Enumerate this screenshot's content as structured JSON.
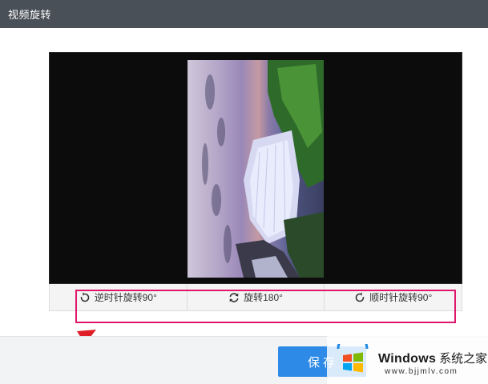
{
  "window": {
    "title": "视频旋转"
  },
  "controls": [
    {
      "label": "逆时针旋转90°",
      "icon": "rotate-ccw-icon"
    },
    {
      "label": "旋转180°",
      "icon": "rotate-180-icon"
    },
    {
      "label": "顺时针旋转90°",
      "icon": "rotate-cw-icon"
    }
  ],
  "footer": {
    "save_label": "保存"
  },
  "watermark": {
    "brand_en": "Windows",
    "brand_cn": "系统之家",
    "url": "www.bjjmlv.com"
  },
  "colors": {
    "titlebar": "#4a5058",
    "accent": "#2d8ae6",
    "highlight": "#e0166a",
    "arrow": "#e01e28"
  }
}
